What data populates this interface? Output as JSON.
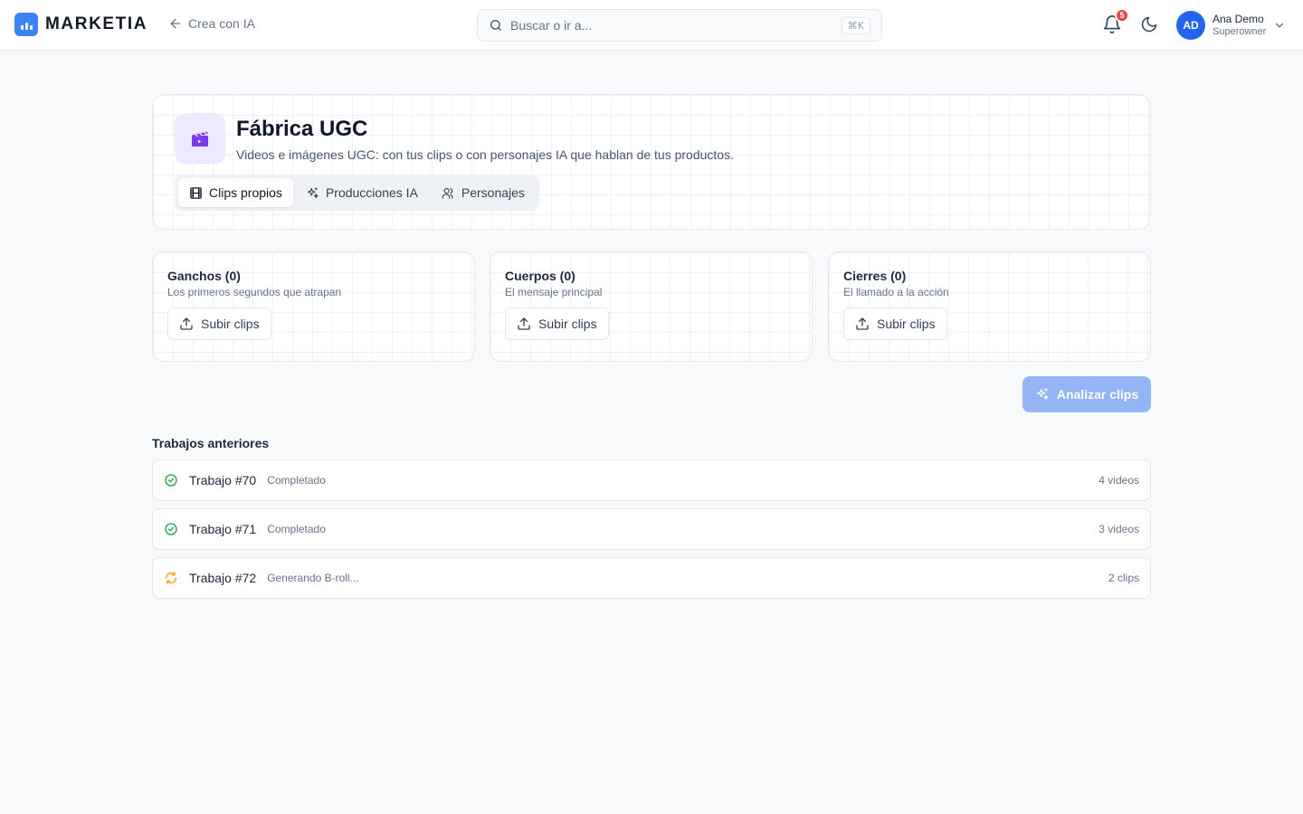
{
  "app": {
    "brand": "MARKETIA",
    "back_label": "Crea con IA",
    "search": {
      "placeholder": "Buscar o ir a...",
      "shortcut": "⌘K"
    },
    "notifications": {
      "count": "5"
    },
    "user": {
      "initials": "AD",
      "name": "Ana Demo",
      "role": "Superowner"
    }
  },
  "page": {
    "title": "Fábrica UGC",
    "subtitle": "Videos e imágenes UGC: con tus clips o con personajes IA que hablan de tus productos.",
    "tabs": [
      {
        "label": "Clips propios",
        "icon": "film-icon",
        "active": true
      },
      {
        "label": "Producciones IA",
        "icon": "sparkles-icon",
        "active": false
      },
      {
        "label": "Personajes",
        "icon": "users-icon",
        "active": false
      }
    ]
  },
  "clip_sections": [
    {
      "title": "Ganchos (0)",
      "description": "Los primeros segundos que atrapan",
      "button": "Subir clips"
    },
    {
      "title": "Cuerpos (0)",
      "description": "El mensaje principal",
      "button": "Subir clips"
    },
    {
      "title": "Cierres (0)",
      "description": "El llamado a la acción",
      "button": "Subir clips"
    }
  ],
  "analyze_button": {
    "label": "Analizar clips",
    "enabled": false
  },
  "jobs": {
    "title": "Trabajos anteriores",
    "items": [
      {
        "name": "Trabajo #70",
        "status": "Completado",
        "count": "4 videos",
        "state": "done"
      },
      {
        "name": "Trabajo #71",
        "status": "Completado",
        "count": "3 videos",
        "state": "done"
      },
      {
        "name": "Trabajo #72",
        "status": "Generando B-roll...",
        "count": "2 clips",
        "state": "processing"
      }
    ]
  },
  "colors": {
    "brand": "#3b82f6",
    "accent_purple": "#7c3aed",
    "success": "#16a34a",
    "warning": "#f59e0b",
    "badge": "#ef4444"
  }
}
